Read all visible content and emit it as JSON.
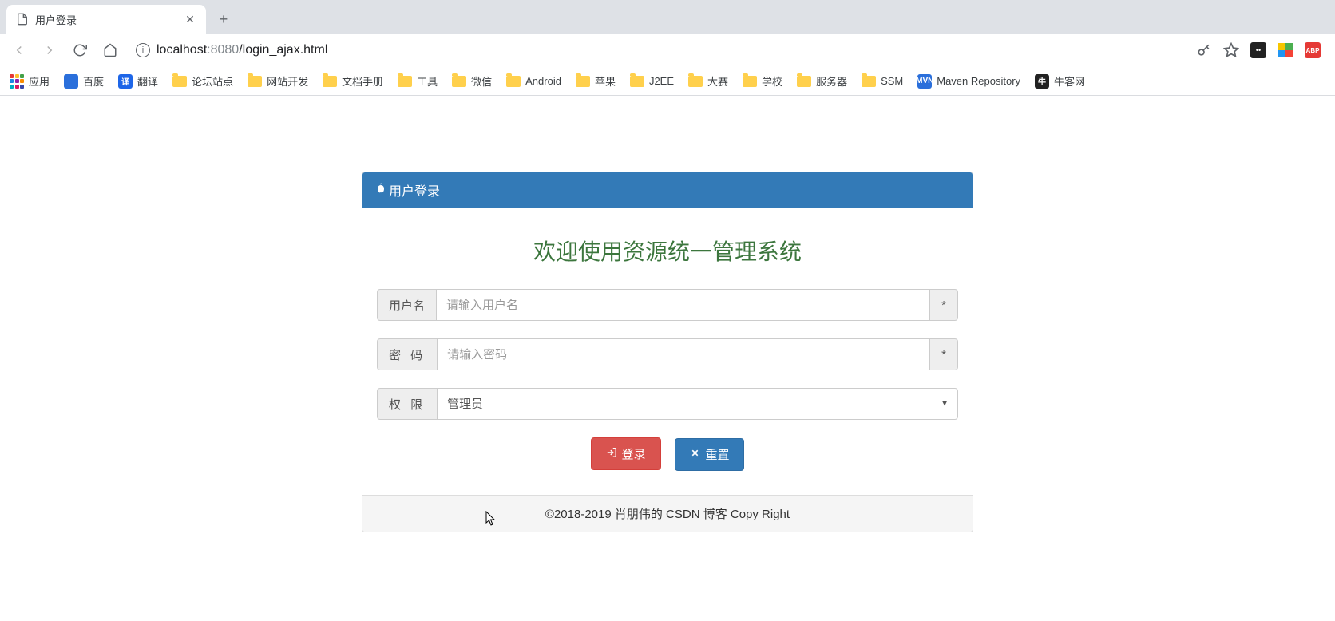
{
  "tab": {
    "title": "用户登录"
  },
  "url": {
    "host": "localhost",
    "port": ":8080",
    "path": "/login_ajax.html"
  },
  "bookmarks": {
    "apps": "应用",
    "items": [
      {
        "label": "百度",
        "type": "custom",
        "bg": "#2a6fdb"
      },
      {
        "label": "翻译",
        "type": "custom",
        "bg": "#1e66e8",
        "txt": "译"
      },
      {
        "label": "论坛站点",
        "type": "folder"
      },
      {
        "label": "网站开发",
        "type": "folder"
      },
      {
        "label": "文档手册",
        "type": "folder"
      },
      {
        "label": "工具",
        "type": "folder"
      },
      {
        "label": "微信",
        "type": "folder"
      },
      {
        "label": "Android",
        "type": "folder"
      },
      {
        "label": "苹果",
        "type": "folder"
      },
      {
        "label": "J2EE",
        "type": "folder"
      },
      {
        "label": "大赛",
        "type": "folder"
      },
      {
        "label": "学校",
        "type": "folder"
      },
      {
        "label": "服务器",
        "type": "folder"
      },
      {
        "label": "SSM",
        "type": "folder"
      },
      {
        "label": "Maven Repository",
        "type": "custom",
        "bg": "#2a6fdb",
        "txt": "MVN"
      },
      {
        "label": "牛客网",
        "type": "custom",
        "bg": "#222",
        "txt": "牛"
      }
    ]
  },
  "panel": {
    "heading": "用户登录",
    "welcome": "欢迎使用资源统一管理系统",
    "username_label": "用户名",
    "username_placeholder": "请输入用户名",
    "password_label": "密 码",
    "password_placeholder": "请输入密码",
    "role_label": "权 限",
    "role_selected": "管理员",
    "asterisk": "*",
    "login_btn": "登录",
    "reset_btn": "重置",
    "footer": "©2018-2019 肖朋伟的 CSDN 博客 Copy Right"
  }
}
